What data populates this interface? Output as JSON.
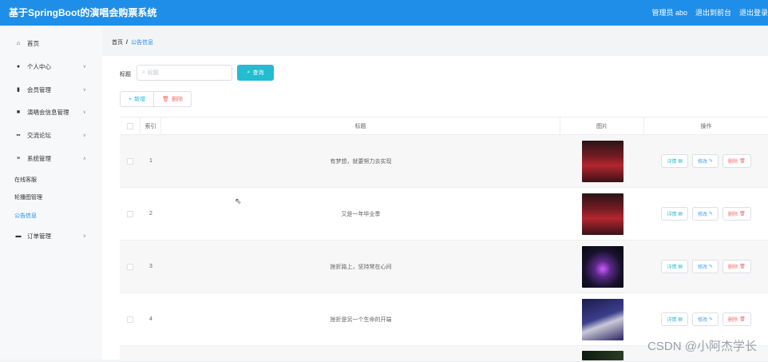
{
  "app": {
    "title": "基于SpringBoot的演唱会购票系统",
    "user_label": "管理员 abo",
    "exit_console": "退出到前台",
    "logout": "退出登录"
  },
  "sidebar": {
    "items": [
      {
        "label": "首页",
        "icon": "home-icon"
      },
      {
        "label": "个人中心",
        "icon": "user-icon"
      },
      {
        "label": "会员管理",
        "icon": "bar-chart-icon"
      },
      {
        "label": "演唱会信息管理",
        "icon": "bag-icon"
      },
      {
        "label": "交流论坛",
        "icon": "grid-icon"
      },
      {
        "label": "系统管理",
        "icon": "menu-icon"
      },
      {
        "label": "订单管理",
        "icon": "chat-icon"
      }
    ],
    "sub_items": [
      "在线客服",
      "轮播图管理",
      "公告信息"
    ]
  },
  "breadcrumb": {
    "home": "首页",
    "sep": "/",
    "current": "公告信息"
  },
  "search": {
    "label": "标题",
    "placeholder": "标题",
    "button": "查询"
  },
  "actions": {
    "add": "新增",
    "delete": "删除"
  },
  "table": {
    "headers": [
      "索引",
      "标题",
      "图片",
      "操作"
    ],
    "rows": [
      {
        "index": "1",
        "title": "有梦想，就要努力去实现"
      },
      {
        "index": "2",
        "title": "又是一年毕业季"
      },
      {
        "index": "3",
        "title": "挫折路上，坚持常在心间"
      },
      {
        "index": "4",
        "title": "挫折是另一个生命的开端"
      }
    ],
    "ops": {
      "detail": "详情",
      "edit": "修改",
      "remove": "删除"
    }
  },
  "watermark": "CSDN @小阿杰学长"
}
